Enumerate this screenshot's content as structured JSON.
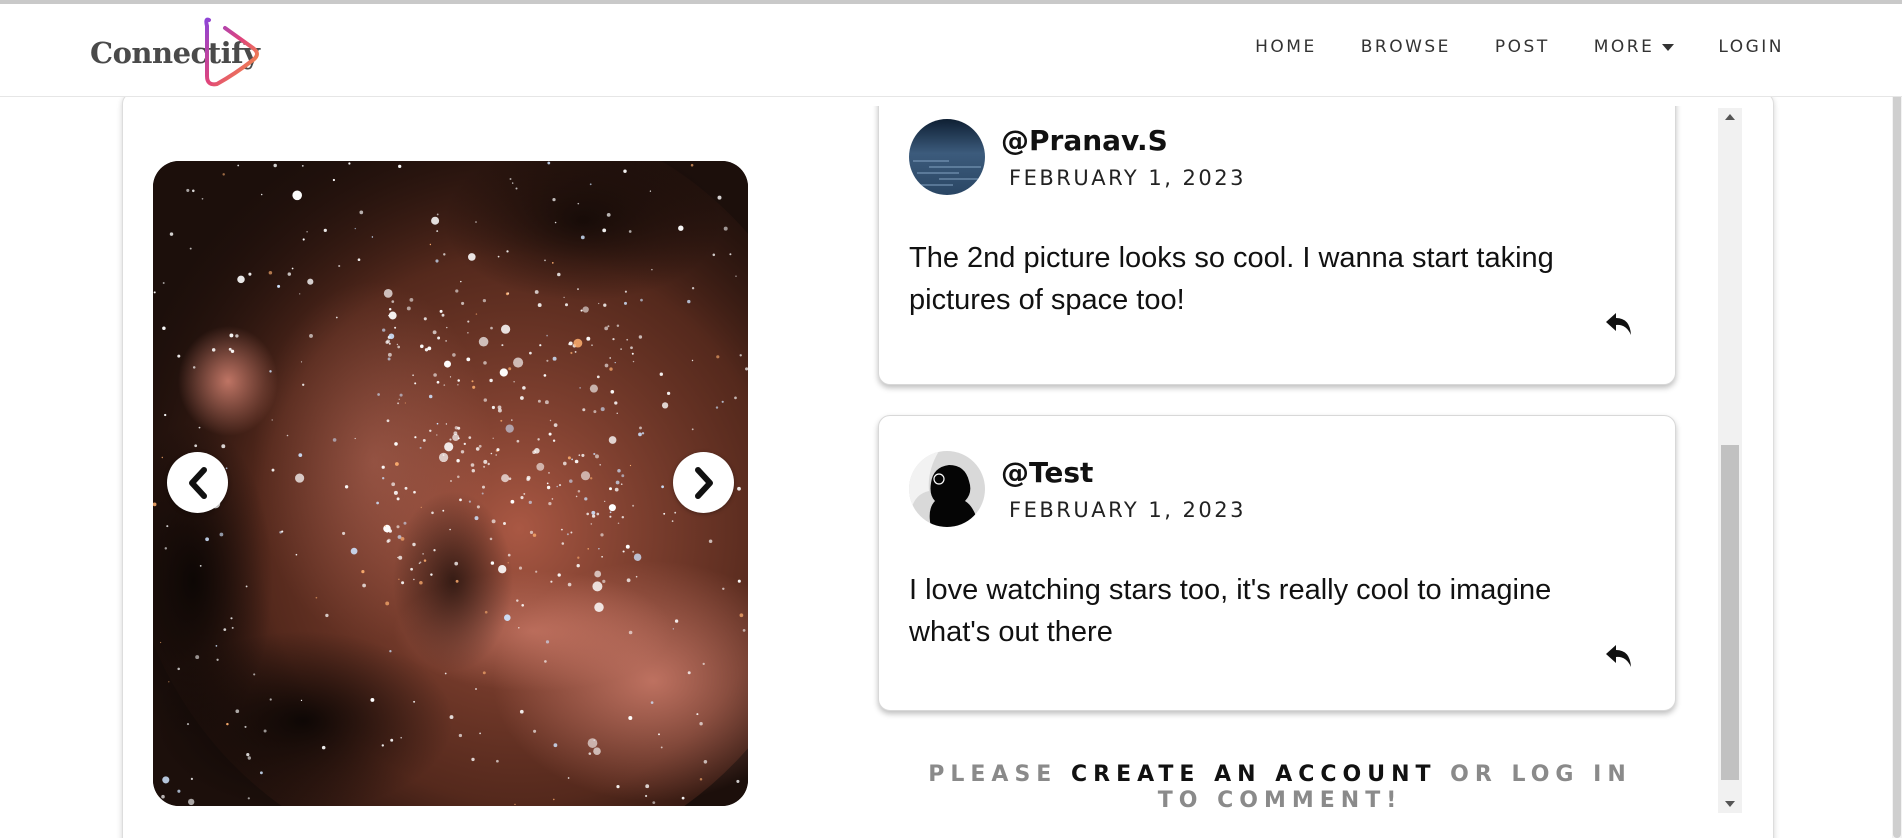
{
  "brand": {
    "name": "Connectify"
  },
  "nav": {
    "items": [
      {
        "label": "HOME"
      },
      {
        "label": "BROWSE"
      },
      {
        "label": "POST"
      },
      {
        "label": "MORE",
        "icon": "caret-down-icon"
      },
      {
        "label": "LOGIN"
      }
    ]
  },
  "carousel": {
    "prev_icon": "chevron-left-icon",
    "next_icon": "chevron-right-icon"
  },
  "comments": [
    {
      "username": "@Pranav.S",
      "date": "FEBRUARY 1, 2023",
      "text": "The 2nd picture looks so cool. I wanna start taking pictures of space too!",
      "reply_icon": "reply-icon"
    },
    {
      "username": "@Test",
      "date": "FEBRUARY 1, 2023",
      "text": "I love watching stars too, it's really cool to imagine what's out there",
      "reply_icon": "reply-icon"
    }
  ],
  "login_prompt": {
    "before": "PLEASE ",
    "link": "CREATE AN ACCOUNT",
    "after": " OR LOG IN TO COMMENT!"
  },
  "colors": {
    "logo_gradient_start": "#8e44d6",
    "logo_gradient_end": "#f7a23b",
    "nebula": "#c76a52",
    "muted_text": "#8a8a8a"
  }
}
